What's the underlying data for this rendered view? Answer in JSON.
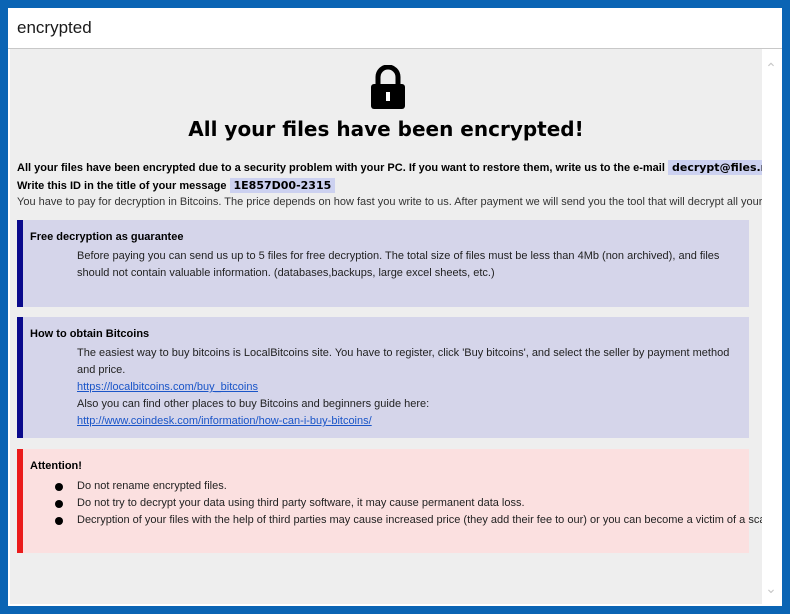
{
  "window": {
    "title": "encrypted"
  },
  "header": {
    "heading": "All your files have been encrypted!"
  },
  "intro": {
    "line1_text": "All your files have been encrypted due to a security problem with your PC. If you want to restore them, write us to the e-mail",
    "email": "decrypt@files.mn",
    "line2_text": "Write this ID in the title of your message",
    "id": "1E857D00-2315",
    "line3_text": "You have to pay for decryption in Bitcoins. The price depends on how fast you write to us. After payment we will send you the tool that will decrypt all your files."
  },
  "free_decryption": {
    "title": "Free decryption as guarantee",
    "text": "Before paying you can send us up to 5 files for free decryption. The total size of files must be less than 4Mb (non archived), and files should not contain valuable information. (databases,backups, large excel sheets, etc.)"
  },
  "bitcoins": {
    "title": "How to obtain Bitcoins",
    "text1": "The easiest way to buy bitcoins is LocalBitcoins site. You have to register, click 'Buy bitcoins', and select the seller by payment method and price.",
    "link1": "https://localbitcoins.com/buy_bitcoins",
    "text2": "Also you can find other places to buy Bitcoins and beginners guide here:",
    "link2": "http://www.coindesk.com/information/how-can-i-buy-bitcoins/"
  },
  "attention": {
    "title": "Attention!",
    "items": [
      "Do not rename encrypted files.",
      "Do not try to decrypt your data using third party software, it may cause permanent data loss.",
      "Decryption of your files with the help of third parties may cause increased price (they add their fee to our) or you can become a victim of a scam."
    ]
  },
  "icons": {
    "lock": "lock-icon",
    "scroll_up": "chevron-up-icon",
    "scroll_down": "chevron-down-icon"
  },
  "colors": {
    "frame": "#0a64b4",
    "info_accent": "#0a0a8c",
    "warning_accent": "#ea1b1b",
    "info_bg": "#d5d5ea",
    "warning_bg": "#fbe0e0"
  }
}
